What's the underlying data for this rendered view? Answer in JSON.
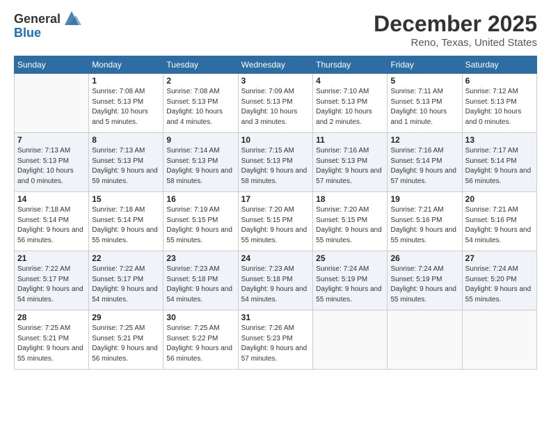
{
  "header": {
    "logo_general": "General",
    "logo_blue": "Blue",
    "month_title": "December 2025",
    "location": "Reno, Texas, United States"
  },
  "days_of_week": [
    "Sunday",
    "Monday",
    "Tuesday",
    "Wednesday",
    "Thursday",
    "Friday",
    "Saturday"
  ],
  "weeks": [
    [
      {
        "day": "",
        "empty": true
      },
      {
        "day": "1",
        "sunrise": "7:08 AM",
        "sunset": "5:13 PM",
        "daylight": "10 hours and 5 minutes."
      },
      {
        "day": "2",
        "sunrise": "7:08 AM",
        "sunset": "5:13 PM",
        "daylight": "10 hours and 4 minutes."
      },
      {
        "day": "3",
        "sunrise": "7:09 AM",
        "sunset": "5:13 PM",
        "daylight": "10 hours and 3 minutes."
      },
      {
        "day": "4",
        "sunrise": "7:10 AM",
        "sunset": "5:13 PM",
        "daylight": "10 hours and 2 minutes."
      },
      {
        "day": "5",
        "sunrise": "7:11 AM",
        "sunset": "5:13 PM",
        "daylight": "10 hours and 1 minute."
      },
      {
        "day": "6",
        "sunrise": "7:12 AM",
        "sunset": "5:13 PM",
        "daylight": "10 hours and 0 minutes."
      }
    ],
    [
      {
        "day": "7",
        "sunrise": "7:13 AM",
        "sunset": "5:13 PM",
        "daylight": "10 hours and 0 minutes."
      },
      {
        "day": "8",
        "sunrise": "7:13 AM",
        "sunset": "5:13 PM",
        "daylight": "9 hours and 59 minutes."
      },
      {
        "day": "9",
        "sunrise": "7:14 AM",
        "sunset": "5:13 PM",
        "daylight": "9 hours and 58 minutes."
      },
      {
        "day": "10",
        "sunrise": "7:15 AM",
        "sunset": "5:13 PM",
        "daylight": "9 hours and 58 minutes."
      },
      {
        "day": "11",
        "sunrise": "7:16 AM",
        "sunset": "5:13 PM",
        "daylight": "9 hours and 57 minutes."
      },
      {
        "day": "12",
        "sunrise": "7:16 AM",
        "sunset": "5:14 PM",
        "daylight": "9 hours and 57 minutes."
      },
      {
        "day": "13",
        "sunrise": "7:17 AM",
        "sunset": "5:14 PM",
        "daylight": "9 hours and 56 minutes."
      }
    ],
    [
      {
        "day": "14",
        "sunrise": "7:18 AM",
        "sunset": "5:14 PM",
        "daylight": "9 hours and 56 minutes."
      },
      {
        "day": "15",
        "sunrise": "7:18 AM",
        "sunset": "5:14 PM",
        "daylight": "9 hours and 55 minutes."
      },
      {
        "day": "16",
        "sunrise": "7:19 AM",
        "sunset": "5:15 PM",
        "daylight": "9 hours and 55 minutes."
      },
      {
        "day": "17",
        "sunrise": "7:20 AM",
        "sunset": "5:15 PM",
        "daylight": "9 hours and 55 minutes."
      },
      {
        "day": "18",
        "sunrise": "7:20 AM",
        "sunset": "5:15 PM",
        "daylight": "9 hours and 55 minutes."
      },
      {
        "day": "19",
        "sunrise": "7:21 AM",
        "sunset": "5:16 PM",
        "daylight": "9 hours and 55 minutes."
      },
      {
        "day": "20",
        "sunrise": "7:21 AM",
        "sunset": "5:16 PM",
        "daylight": "9 hours and 54 minutes."
      }
    ],
    [
      {
        "day": "21",
        "sunrise": "7:22 AM",
        "sunset": "5:17 PM",
        "daylight": "9 hours and 54 minutes."
      },
      {
        "day": "22",
        "sunrise": "7:22 AM",
        "sunset": "5:17 PM",
        "daylight": "9 hours and 54 minutes."
      },
      {
        "day": "23",
        "sunrise": "7:23 AM",
        "sunset": "5:18 PM",
        "daylight": "9 hours and 54 minutes."
      },
      {
        "day": "24",
        "sunrise": "7:23 AM",
        "sunset": "5:18 PM",
        "daylight": "9 hours and 54 minutes."
      },
      {
        "day": "25",
        "sunrise": "7:24 AM",
        "sunset": "5:19 PM",
        "daylight": "9 hours and 55 minutes."
      },
      {
        "day": "26",
        "sunrise": "7:24 AM",
        "sunset": "5:19 PM",
        "daylight": "9 hours and 55 minutes."
      },
      {
        "day": "27",
        "sunrise": "7:24 AM",
        "sunset": "5:20 PM",
        "daylight": "9 hours and 55 minutes."
      }
    ],
    [
      {
        "day": "28",
        "sunrise": "7:25 AM",
        "sunset": "5:21 PM",
        "daylight": "9 hours and 55 minutes."
      },
      {
        "day": "29",
        "sunrise": "7:25 AM",
        "sunset": "5:21 PM",
        "daylight": "9 hours and 56 minutes."
      },
      {
        "day": "30",
        "sunrise": "7:25 AM",
        "sunset": "5:22 PM",
        "daylight": "9 hours and 56 minutes."
      },
      {
        "day": "31",
        "sunrise": "7:26 AM",
        "sunset": "5:23 PM",
        "daylight": "9 hours and 57 minutes."
      },
      {
        "day": "",
        "empty": true
      },
      {
        "day": "",
        "empty": true
      },
      {
        "day": "",
        "empty": true
      }
    ]
  ],
  "labels": {
    "sunrise": "Sunrise:",
    "sunset": "Sunset:",
    "daylight": "Daylight:"
  }
}
